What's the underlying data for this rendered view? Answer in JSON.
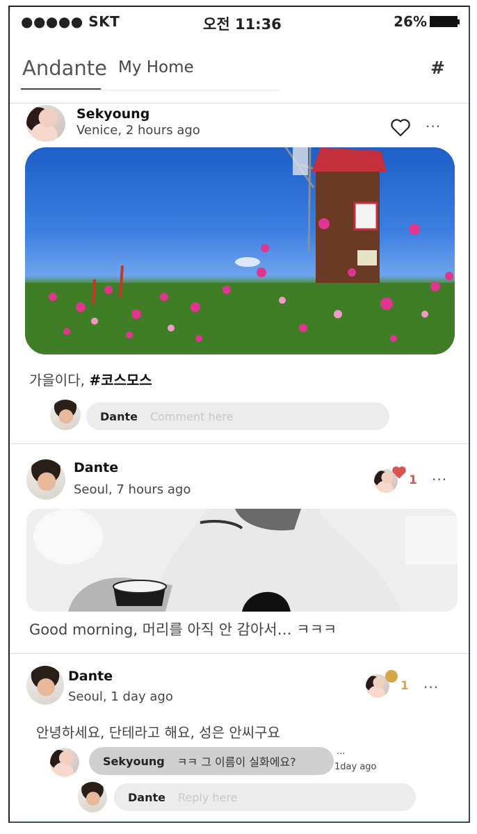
{
  "status_bar": {
    "carrier": "●●●●● SKT",
    "time": "오전 11:36",
    "battery": "26%"
  },
  "header": {
    "brand": "Andante",
    "tab": "My Home",
    "hash_icon": "#"
  },
  "posts": [
    {
      "author": "Sekyoung",
      "meta": "Venice, 2 hours ago",
      "caption_plain": "가을이다, ",
      "caption_tag": "#코스모스",
      "comment_input": {
        "name": "Dante",
        "placeholder": "Comment here"
      },
      "dots": "···"
    },
    {
      "author": "Dante",
      "meta": "Seoul, 7 hours ago",
      "like_count": "1",
      "caption": "Good morning,  머리를 아직 안 감아서… ㅋㅋㅋ",
      "dots": "···"
    },
    {
      "author": "Dante",
      "meta": "Seoul, 1 day ago",
      "like_count": "1",
      "caption": "안녕하세요, 단테라고 해요, 성은 안씨구요",
      "reply": {
        "name": "Sekyoung",
        "text": "ㅋㅋ 그 이름이 실화에요?",
        "dots": "···",
        "time": "1day ago"
      },
      "reply_input": {
        "name": "Dante",
        "placeholder": "Reply here"
      },
      "dots": "···"
    }
  ],
  "colors": {
    "like_red": "#d9534f",
    "like_gold": "#d4a84a",
    "pill": "#ececec"
  }
}
